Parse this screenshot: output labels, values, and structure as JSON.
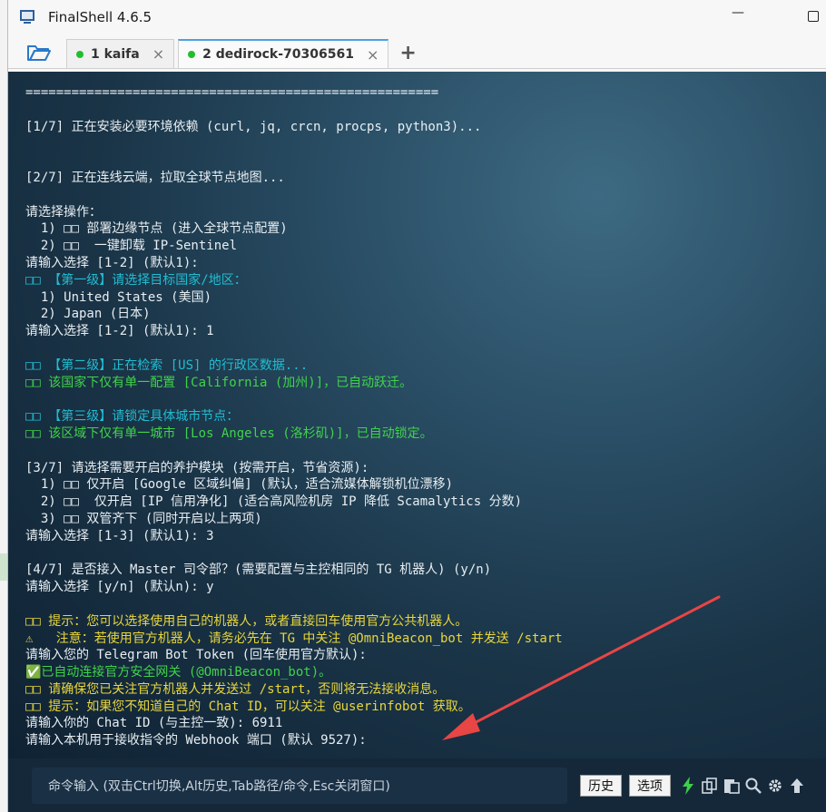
{
  "window": {
    "title": "FinalShell 4.6.5",
    "minimize_glyph": "—"
  },
  "tabs": [
    {
      "label": "1 kaifa",
      "close_glyph": "×",
      "active": false
    },
    {
      "label": "2 dedirock-70306561",
      "close_glyph": "×",
      "active": true
    }
  ],
  "add_tab_glyph": "+",
  "terminal_lines": [
    {
      "color": "white",
      "text": "======================================================"
    },
    {
      "color": "white",
      "text": ""
    },
    {
      "color": "white",
      "text": "[1/7] 正在安装必要环境依赖 (curl, jq, crcn, procps, python3)..."
    },
    {
      "color": "white",
      "text": ""
    },
    {
      "color": "white",
      "text": ""
    },
    {
      "color": "white",
      "text": "[2/7] 正在连线云端，拉取全球节点地图..."
    },
    {
      "color": "white",
      "text": ""
    },
    {
      "color": "white",
      "text": "请选择操作："
    },
    {
      "color": "white",
      "text": "  1) □□ 部署边缘节点 (进入全球节点配置)"
    },
    {
      "color": "white",
      "text": "  2) □□  一键卸载 IP-Sentinel"
    },
    {
      "color": "white",
      "text": "请输入选择 [1-2] (默认1):"
    },
    {
      "color": "cyan",
      "text": "□□ 【第一级】请选择目标国家/地区："
    },
    {
      "color": "white",
      "text": "  1) United States (美国)"
    },
    {
      "color": "white",
      "text": "  2) Japan (日本)"
    },
    {
      "color": "white",
      "text": "请输入选择 [1-2] (默认1): 1"
    },
    {
      "color": "white",
      "text": ""
    },
    {
      "color": "cyan",
      "text": "□□ 【第二级】正在检索 [US] 的行政区数据..."
    },
    {
      "color": "green",
      "text": "□□ 该国家下仅有单一配置 [California (加州)]，已自动跃迁。"
    },
    {
      "color": "white",
      "text": ""
    },
    {
      "color": "cyan",
      "text": "□□ 【第三级】请锁定具体城市节点："
    },
    {
      "color": "green",
      "text": "□□ 该区域下仅有单一城市 [Los Angeles (洛杉矶)]，已自动锁定。"
    },
    {
      "color": "white",
      "text": ""
    },
    {
      "color": "white",
      "text": "[3/7] 请选择需要开启的养护模块 (按需开启，节省资源):"
    },
    {
      "color": "white",
      "text": "  1) □□ 仅开启 [Google 区域纠偏] (默认，适合流媒体解锁机位漂移)"
    },
    {
      "color": "white",
      "text": "  2) □□  仅开启 [IP 信用净化] (适合高风险机房 IP 降低 Scamalytics 分数)"
    },
    {
      "color": "white",
      "text": "  3) □□ 双管齐下 (同时开启以上两项)"
    },
    {
      "color": "white",
      "text": "请输入选择 [1-3] (默认1): 3"
    },
    {
      "color": "white",
      "text": ""
    },
    {
      "color": "white",
      "text": "[4/7] 是否接入 Master 司令部？(需要配置与主控相同的 TG 机器人) (y/n)"
    },
    {
      "color": "white",
      "text": "请输入选择 [y/n] (默认n): y"
    },
    {
      "color": "white",
      "text": ""
    },
    {
      "color": "yellow",
      "text": "□□ 提示：您可以选择使用自己的机器人，或者直接回车使用官方公共机器人。"
    },
    {
      "color": "yellow",
      "text": "⚠   注意：若使用官方机器人，请务必先在 TG 中关注 @OmniBeacon_bot 并发送 /start"
    },
    {
      "color": "white",
      "text": "请输入您的 Telegram Bot Token (回车使用官方默认):"
    },
    {
      "color": "green",
      "text": "✅已自动连接官方安全网关 (@OmniBeacon_bot)。"
    },
    {
      "color": "yellow",
      "text": "□□ 请确保您已关注官方机器人并发送过 /start，否则将无法接收消息。"
    },
    {
      "color": "yellow",
      "text": "□□ 提示：如果您不知道自己的 Chat ID，可以关注 @userinfobot 获取。"
    },
    {
      "color": "white",
      "text": "请输入你的 Chat ID (与主控一致): 6911"
    },
    {
      "color": "white",
      "text": "请输入本机用于接收指令的 Webhook 端口 (默认 9527):"
    }
  ],
  "cmdbar": {
    "placeholder": "命令输入 (双击Ctrl切换,Alt历史,Tab路径/命令,Esc关闭窗口)",
    "history_label": "历史",
    "options_label": "选项"
  },
  "annotation_arrow_color": "#e84545",
  "icons": [
    "folder-icon",
    "lightning-icon",
    "copy-icon",
    "paste-icon",
    "search-icon",
    "gear-icon",
    "arrow-up-icon"
  ]
}
